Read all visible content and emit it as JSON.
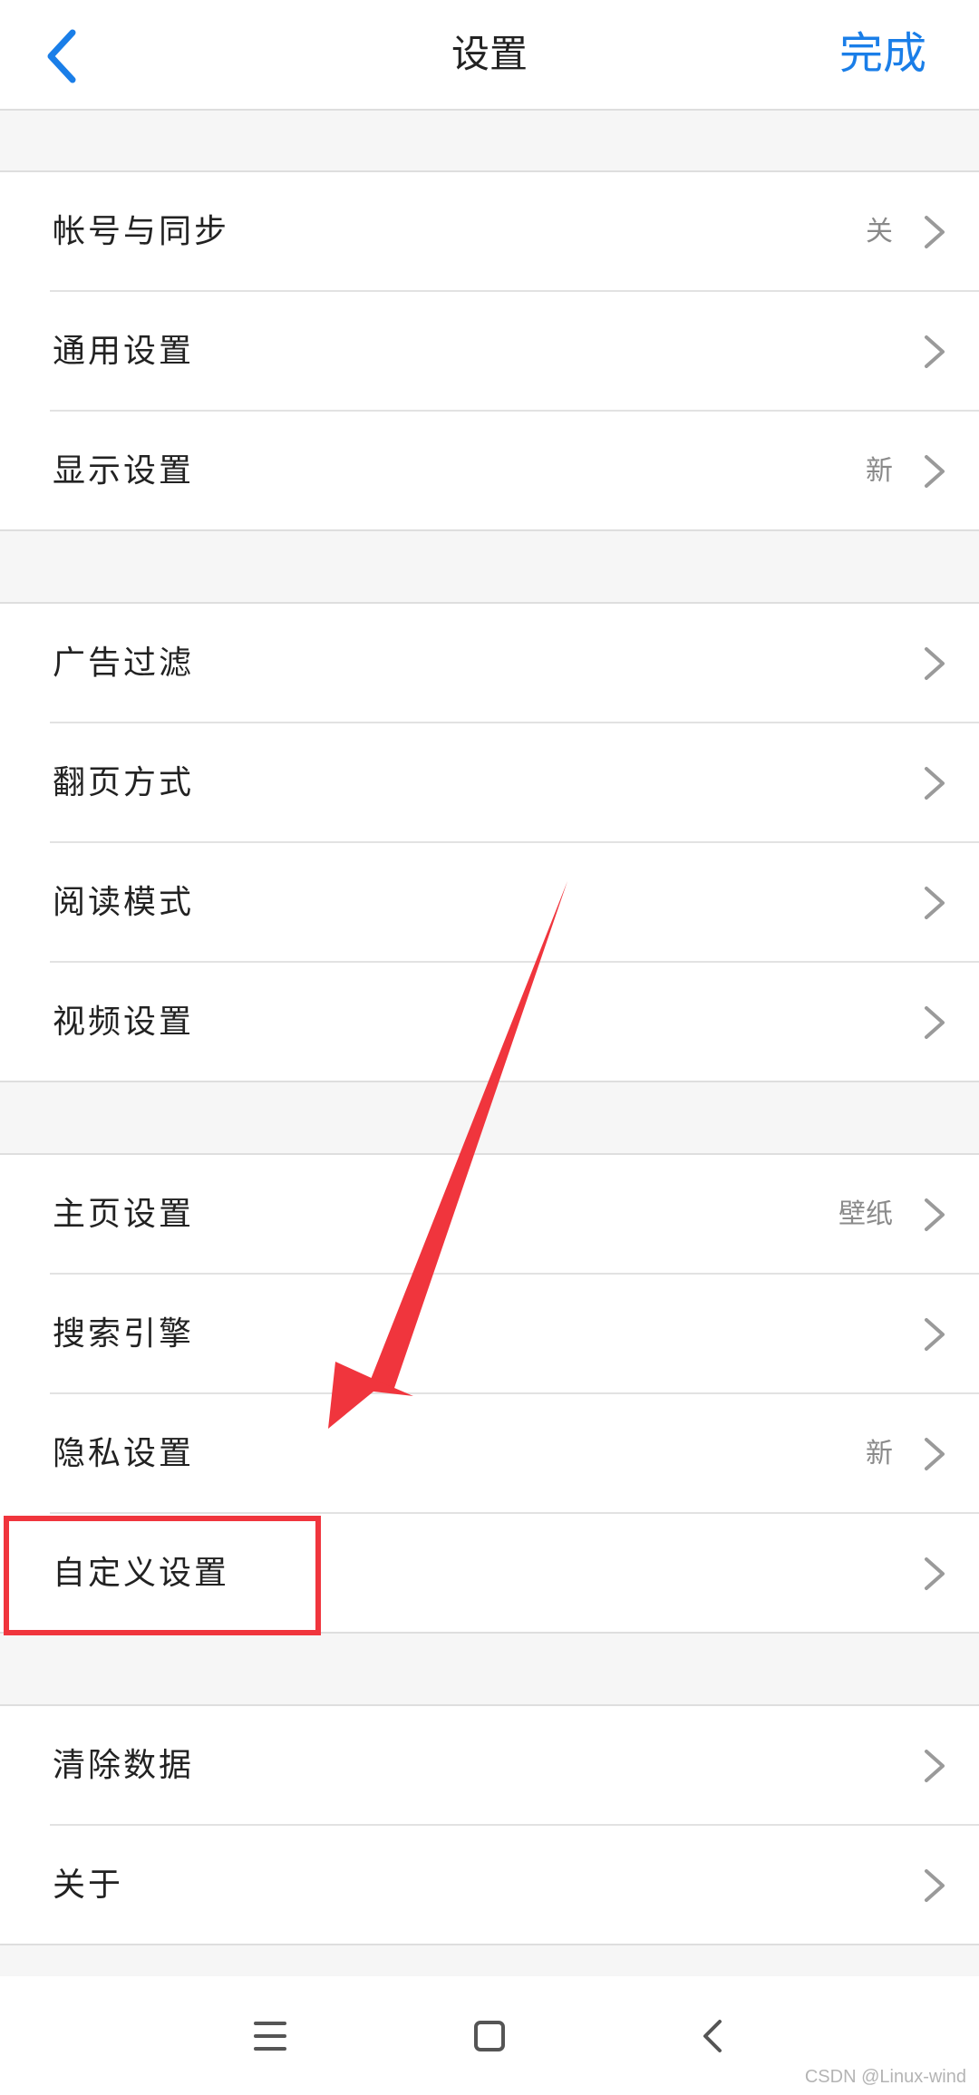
{
  "header": {
    "title": "设置",
    "done_label": "完成",
    "back_icon": "chevron-left-icon",
    "accent_color": "#1a7ee8"
  },
  "sections": [
    {
      "items": [
        {
          "label": "帐号与同步",
          "value": "关"
        },
        {
          "label": "通用设置",
          "value": ""
        },
        {
          "label": "显示设置",
          "value": "新"
        }
      ]
    },
    {
      "items": [
        {
          "label": "广告过滤",
          "value": ""
        },
        {
          "label": "翻页方式",
          "value": ""
        },
        {
          "label": "阅读模式",
          "value": ""
        },
        {
          "label": "视频设置",
          "value": ""
        }
      ]
    },
    {
      "items": [
        {
          "label": "主页设置",
          "value": "壁纸"
        },
        {
          "label": "搜索引擎",
          "value": ""
        },
        {
          "label": "隐私设置",
          "value": "新"
        },
        {
          "label": "自定义设置",
          "value": ""
        }
      ]
    },
    {
      "items": [
        {
          "label": "清除数据",
          "value": ""
        },
        {
          "label": "关于",
          "value": ""
        }
      ]
    }
  ],
  "row_icon": "chevron-right-icon",
  "nav_bar": {
    "menu_icon": "menu-icon",
    "home_icon": "home-square-icon",
    "back_icon": "back-triangle-icon"
  },
  "annotation": {
    "highlight_color": "#f0353d"
  },
  "watermark": "CSDN @Linux-wind"
}
